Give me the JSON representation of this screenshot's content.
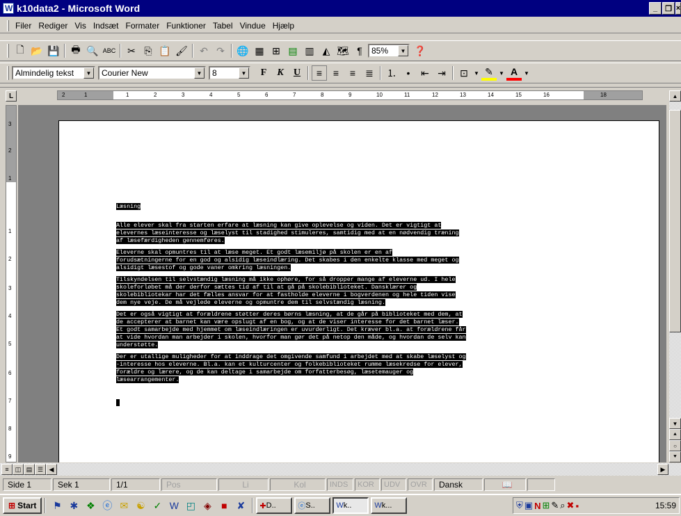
{
  "window": {
    "title": "k10data2 - Microsoft Word"
  },
  "menu": [
    "Filer",
    "Rediger",
    "Vis",
    "Indsæt",
    "Formater",
    "Funktioner",
    "Tabel",
    "Vindue",
    "Hjælp"
  ],
  "toolbar_standard": {
    "zoom": "85%"
  },
  "toolbar_format": {
    "style": "Almindelig tekst",
    "font": "Courier New",
    "size": "8",
    "bold": "F",
    "italic": "K",
    "underline": "U"
  },
  "ruler": {
    "marks": [
      "2",
      "1",
      "1",
      "2",
      "3",
      "4",
      "5",
      "6",
      "7",
      "8",
      "9",
      "10",
      "11",
      "12",
      "13",
      "14",
      "15",
      "16",
      "18"
    ]
  },
  "vruler": {
    "marks": [
      "3",
      "2",
      "1",
      "1",
      "2",
      "3",
      "4",
      "5",
      "6",
      "7",
      "8",
      "9"
    ]
  },
  "document": {
    "heading": "Læsning",
    "paragraphs": [
      [
        "Alle elever skal fra starten erfare at læsning kan give oplevelse og viden. Det er vigtigt at",
        "elevernes læseinteresse og læselyst til stadighed stimuleres, samtidig med at en nødvendig træning",
        "af læsefærdigheden gennemføres."
      ],
      [
        "Eleverne skal opmuntres til at læse meget. Et godt læsemiljø på skolen er en af",
        "forudsætningerne for en god og alsidig læseindlæring. Det skabes i den enkelte klasse med meget og",
        "alsidigt læsestof og gode vaner omkring læsningen."
      ],
      [
        "Tilskyndelsen til selvstændig læsning må ikke ophøre, for så dropper mange af eleverne ud. I hele",
        "skoleforløbet må der derfor sættes tid af til at gå på skolebiblioteket. Dansklærer og",
        "skolebibliotekar har det fælles ansvar for at fastholde eleverne i bogverdenen og hele tiden vise",
        "dem nye veje. De må vejlede eleverne og opmuntre dem til selvstændig læsning."
      ],
      [
        "Det er også vigtigt at forældrene støtter deres børns læsning, at de går på biblioteket med dem, at",
        "de accepterer at barnet kan være opslugt af en bog, og at de viser interesse for det barnet læser.",
        "Et godt samarbejde med hjemmet om læseindlæringen er uvurderligt. Det kræver bl.a. at forældrene får",
        "at vide hvordan man arbejder i skolen, hvorfor man gør det på netop den måde, og hvordan de selv kan",
        "understøtte."
      ],
      [
        "Der er utallige muligheder for at inddrage det omgivende samfund i arbejdet med at skabe læselyst og",
        "-interesse hos eleverne. Bl.a. kan et kulturcenter og folkebiblioteket rumme læsekredse for elever,",
        "forældre og lærere, og de kan deltage i samarbejde om forfatterbesøg, læsetemauger og",
        "læsearrangementer."
      ]
    ]
  },
  "statusbar": {
    "side": "Side 1",
    "sek": "Sek 1",
    "pages": "1/1",
    "pos": "Pos",
    "li": "Li",
    "kol": "Kol",
    "inds": "INDS",
    "kor": "KOR",
    "udv": "UDV",
    "ovr": "OVR",
    "lang": "Dansk"
  },
  "taskbar": {
    "start": "Start",
    "tasks": [
      "D..",
      "S..",
      "k..",
      "k..."
    ],
    "clock": "15:59"
  }
}
